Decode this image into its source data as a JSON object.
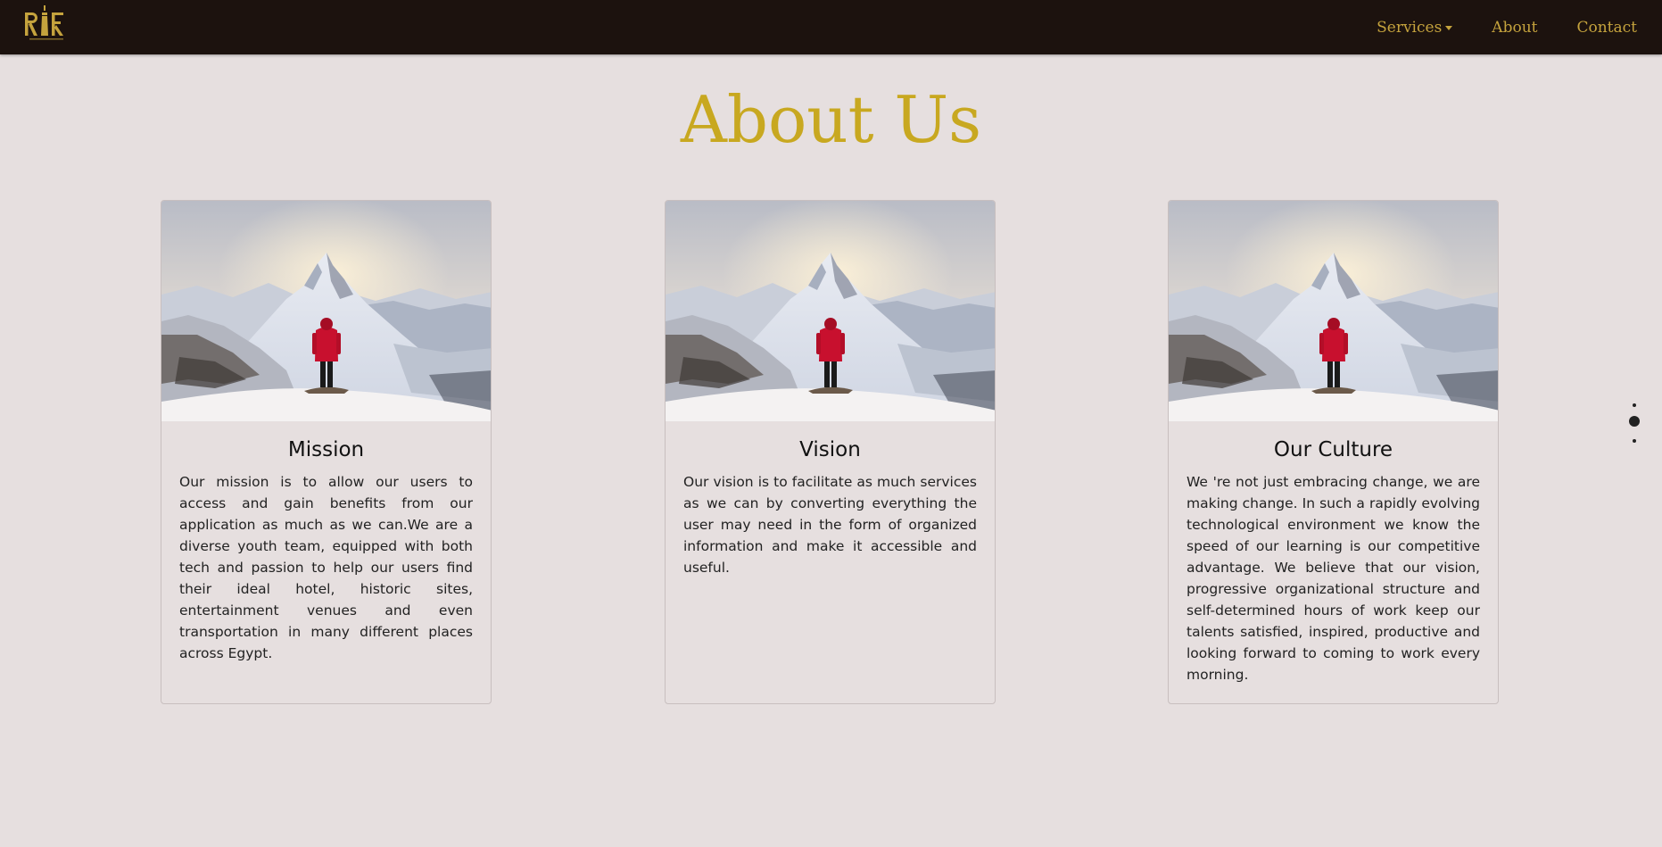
{
  "navbar": {
    "logo_text": "RIF",
    "links": {
      "services": "Services",
      "about": "About",
      "contact": "Contact"
    }
  },
  "page": {
    "title": "About Us"
  },
  "cards": [
    {
      "title": "Mission",
      "text": "Our mission is to allow our users to access and gain benefits from our application as much as we can.We are a diverse youth team, equipped with both tech and passion to help our users find their ideal hotel, historic sites, entertainment venues and even transportation in many different places across Egypt."
    },
    {
      "title": "Vision",
      "text": "Our vision is to facilitate as much services as we can by converting everything the user may need in the form of organized information and make it accessible and useful."
    },
    {
      "title": "Our Culture",
      "text": "We 're not just embracing change, we are making change. In such a rapidly evolving technological environment we know the speed of our learning is our competitive advantage. We believe that our vision, progressive organizational structure and self-determined hours of work keep our talents satisfied, inspired, productive and looking forward to coming to work every morning."
    }
  ],
  "pagination": {
    "active_index": 1
  },
  "colors": {
    "navbar_bg": "#1c120e",
    "accent_gold": "#c5a33d",
    "title_gold": "#c8a820",
    "page_bg": "#e6dfdf"
  }
}
